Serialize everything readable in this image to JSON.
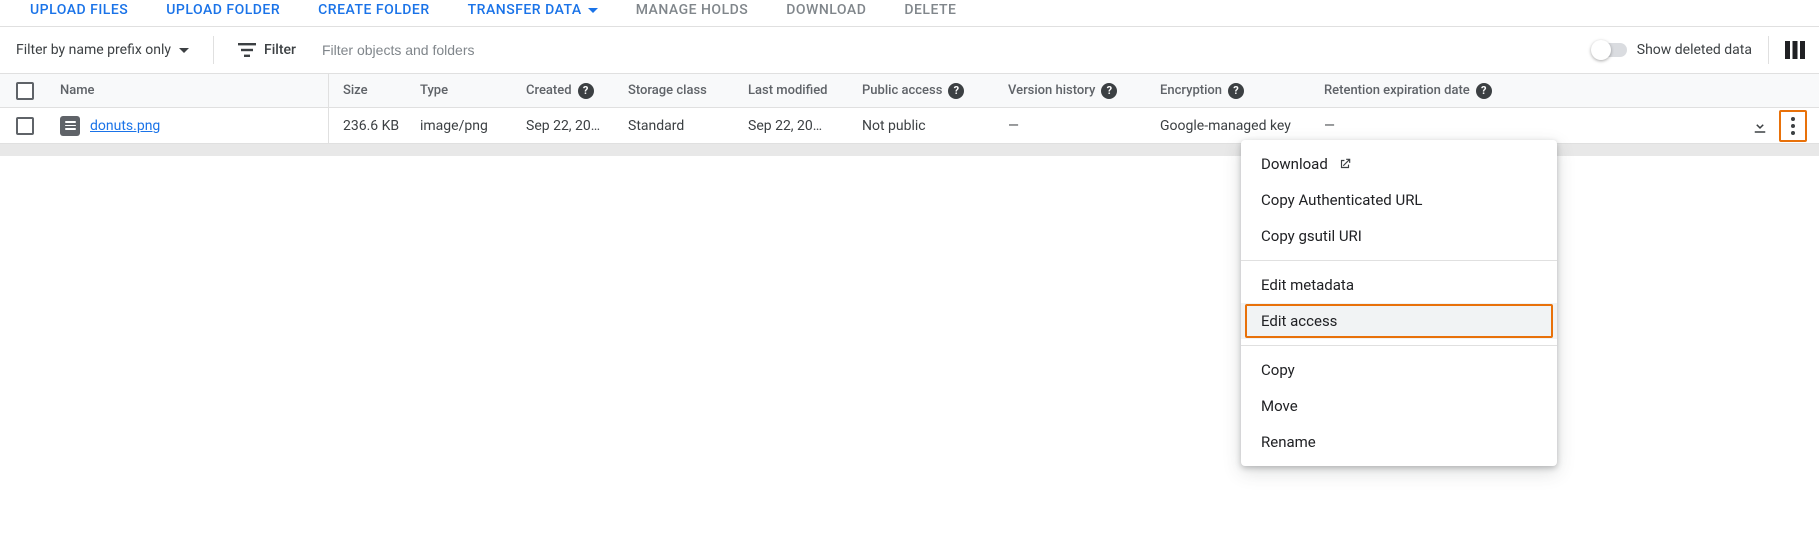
{
  "actions": {
    "upload_files": "UPLOAD FILES",
    "upload_folder": "UPLOAD FOLDER",
    "create_folder": "CREATE FOLDER",
    "transfer_data": "TRANSFER DATA",
    "manage_holds": "MANAGE HOLDS",
    "download": "DOWNLOAD",
    "delete": "DELETE"
  },
  "filter": {
    "mode_label": "Filter by name prefix only",
    "filter_label": "Filter",
    "placeholder": "Filter objects and folders",
    "value": "",
    "show_deleted_label": "Show deleted data"
  },
  "columns": {
    "name": "Name",
    "size": "Size",
    "type": "Type",
    "created": "Created",
    "storage_class": "Storage class",
    "last_modified": "Last modified",
    "public_access": "Public access",
    "version_history": "Version history",
    "encryption": "Encryption",
    "retention": "Retention expiration date"
  },
  "rows": [
    {
      "name": "donuts.png",
      "size": "236.6 KB",
      "type": "image/png",
      "created": "Sep 22, 20…",
      "storage_class": "Standard",
      "last_modified": "Sep 22, 20…",
      "public_access": "Not public",
      "version_history": "—",
      "encryption": "Google-managed key",
      "retention": "—"
    }
  ],
  "menu": {
    "download": "Download",
    "copy_auth_url": "Copy Authenticated URL",
    "copy_gsutil": "Copy gsutil URI",
    "edit_metadata": "Edit metadata",
    "edit_access": "Edit access",
    "copy": "Copy",
    "move": "Move",
    "rename": "Rename"
  }
}
